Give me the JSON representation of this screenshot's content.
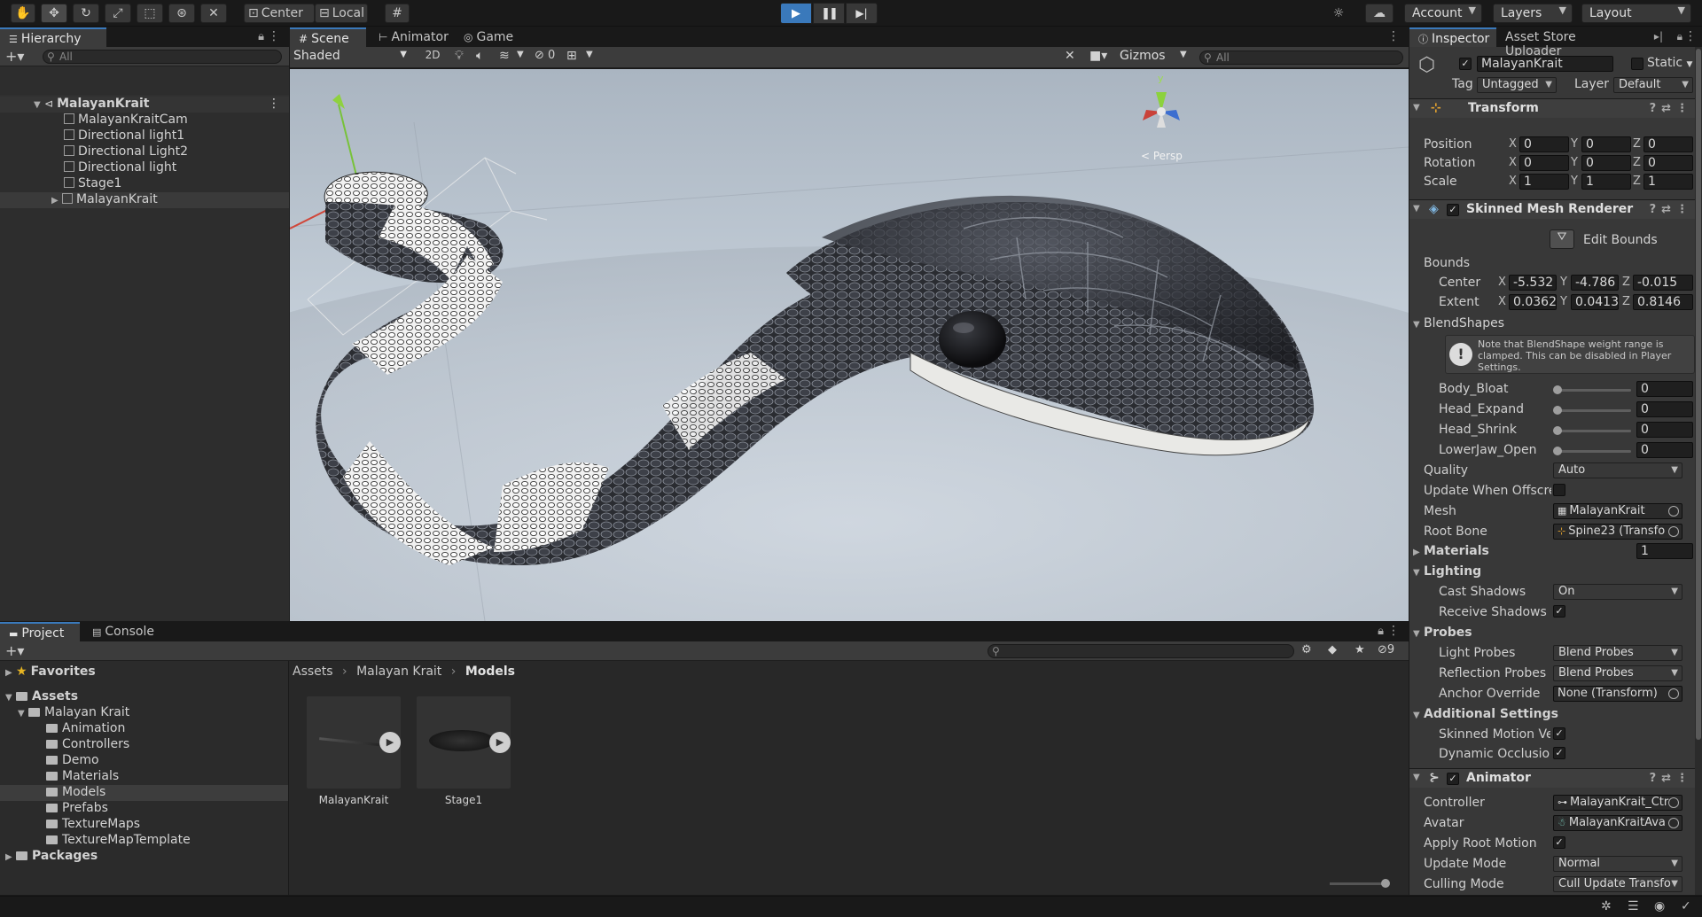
{
  "toolbar": {
    "tools": [
      "hand-tool",
      "move-tool",
      "rotate-tool",
      "scale-tool",
      "rect-tool",
      "transform-tool",
      "custom-tool"
    ],
    "pivot_label": "Center",
    "space_label": "Local",
    "account_label": "Account",
    "layers_label": "Layers",
    "layout_label": "Layout"
  },
  "hierarchy": {
    "tab_label": "Hierarchy",
    "search_placeholder": "All",
    "scene_name": "MalayanKrait",
    "items": [
      {
        "label": "MalayanKraitCam"
      },
      {
        "label": "Directional light1"
      },
      {
        "label": "Directional Light2"
      },
      {
        "label": "Directional light"
      },
      {
        "label": "Stage1"
      },
      {
        "label": "MalayanKrait"
      }
    ]
  },
  "scene_view": {
    "tabs": [
      {
        "label": "Scene"
      },
      {
        "label": "Animator"
      },
      {
        "label": "Game"
      }
    ],
    "shading_mode": "Shaded",
    "mode_2d": "2D",
    "hidden_count": "0",
    "gizmos_label": "Gizmos",
    "search_placeholder": "All",
    "persp_label": "< Persp",
    "axis_y": "y"
  },
  "project": {
    "tabs": [
      {
        "label": "Project"
      },
      {
        "label": "Console"
      }
    ],
    "favorites_label": "Favorites",
    "assets_label": "Assets",
    "root_folder": "Malayan Krait",
    "folders": [
      "Animation",
      "Controllers",
      "Demo",
      "Materials",
      "Models",
      "Prefabs",
      "TextureMaps",
      "TextureMapTemplate"
    ],
    "packages_label": "Packages",
    "breadcrumb": [
      "Assets",
      "Malayan Krait",
      "Models"
    ],
    "hidden_count": "9",
    "assets": [
      {
        "label": "MalayanKrait"
      },
      {
        "label": "Stage1"
      }
    ]
  },
  "inspector": {
    "tabs": [
      {
        "label": "Inspector"
      },
      {
        "label": "Asset Store Uploader"
      }
    ],
    "object_name": "MalayanKrait",
    "static_label": "Static",
    "tag_label": "Tag",
    "tag_value": "Untagged",
    "layer_label": "Layer",
    "layer_value": "Default",
    "transform": {
      "title": "Transform",
      "position_label": "Position",
      "position": {
        "x": "0",
        "y": "0",
        "z": "0"
      },
      "rotation_label": "Rotation",
      "rotation": {
        "x": "0",
        "y": "0",
        "z": "0"
      },
      "scale_label": "Scale",
      "scale": {
        "x": "1",
        "y": "1",
        "z": "1"
      }
    },
    "smr": {
      "title": "Skinned Mesh Renderer",
      "edit_bounds": "Edit Bounds",
      "bounds_label": "Bounds",
      "center_label": "Center",
      "center": {
        "x": "-5.532",
        "y": "-4.786",
        "z": "-0.015"
      },
      "extent_label": "Extent",
      "extent": {
        "x": "0.0362",
        "y": "0.0413",
        "z": "0.8146"
      },
      "blendshapes_label": "BlendShapes",
      "note": "Note that BlendShape weight range is clamped. This can be disabled in Player Settings.",
      "blendshapes": [
        {
          "label": "Body_Bloat",
          "value": "0"
        },
        {
          "label": "Head_Expand",
          "value": "0"
        },
        {
          "label": "Head_Shrink",
          "value": "0"
        },
        {
          "label": "LowerJaw_Open",
          "value": "0"
        }
      ],
      "quality_label": "Quality",
      "quality_value": "Auto",
      "update_offscreen_label": "Update When Offscre",
      "mesh_label": "Mesh",
      "mesh_value": "MalayanKrait",
      "root_bone_label": "Root Bone",
      "root_bone_value": "Spine23 (Transfo",
      "materials_label": "Materials",
      "materials_count": "1",
      "lighting_label": "Lighting",
      "cast_shadows_label": "Cast Shadows",
      "cast_shadows_value": "On",
      "receive_shadows_label": "Receive Shadows",
      "probes_label": "Probes",
      "light_probes_label": "Light Probes",
      "light_probes_value": "Blend Probes",
      "reflection_probes_label": "Reflection Probes",
      "reflection_probes_value": "Blend Probes",
      "anchor_label": "Anchor Override",
      "anchor_value": "None (Transform)",
      "additional_label": "Additional Settings",
      "skinned_motion_label": "Skinned Motion Ve",
      "dynamic_occlusion_label": "Dynamic Occlusior"
    },
    "animator": {
      "title": "Animator",
      "controller_label": "Controller",
      "controller_value": "MalayanKrait_Ctr",
      "avatar_label": "Avatar",
      "avatar_value": "MalayanKraitAva",
      "apply_root_label": "Apply Root Motion",
      "update_mode_label": "Update Mode",
      "update_mode_value": "Normal",
      "culling_label": "Culling Mode",
      "culling_value": "Cull Update Transfo"
    }
  },
  "colors": {
    "accent": "#3a79bb",
    "panel": "#282828",
    "dark": "#191919",
    "sky": "#c9d3dd"
  }
}
